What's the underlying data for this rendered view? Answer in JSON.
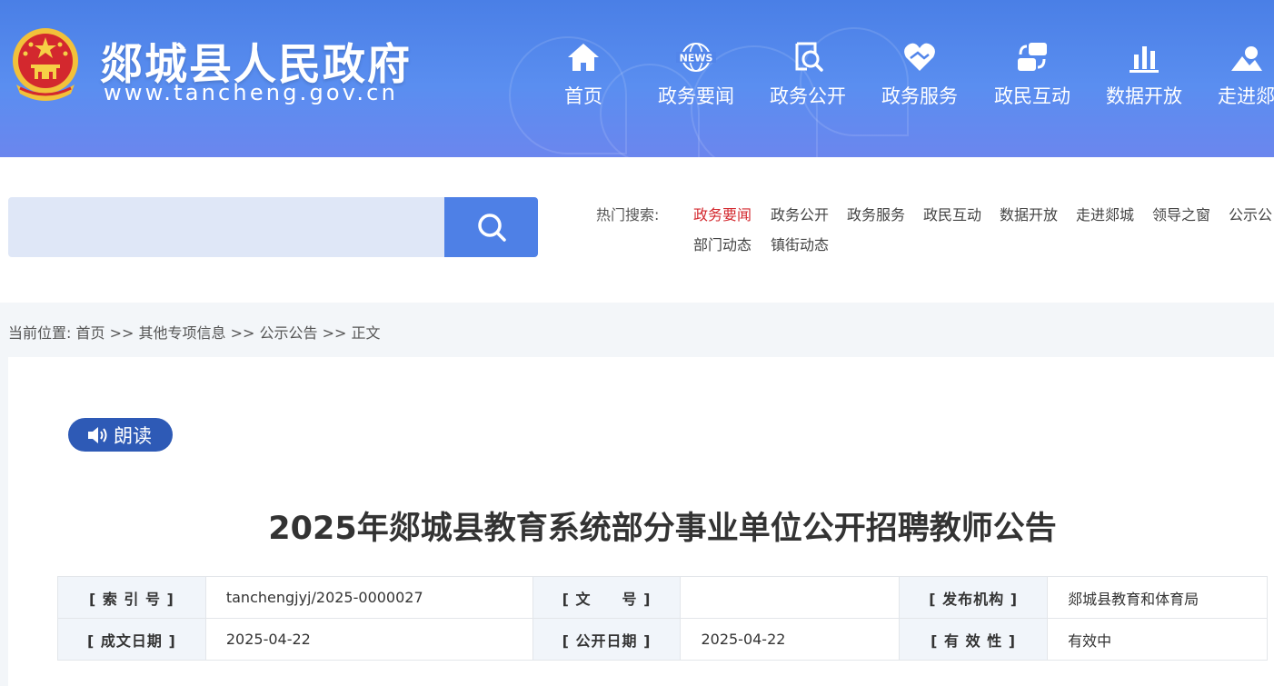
{
  "header": {
    "site_title": "郯城县人民政府",
    "site_url": "www.tancheng.gov.cn",
    "brand_color": "#4a7fe6",
    "nav": [
      {
        "label": "首页",
        "icon": "home-icon"
      },
      {
        "label": "政务要闻",
        "icon": "news-globe-icon",
        "icon_text": "NEWS"
      },
      {
        "label": "政务公开",
        "icon": "document-search-icon"
      },
      {
        "label": "政务服务",
        "icon": "heart-hands-icon"
      },
      {
        "label": "政民互动",
        "icon": "chat-exchange-icon"
      },
      {
        "label": "数据开放",
        "icon": "bar-chart-icon"
      },
      {
        "label": "走进郯"
      }
    ]
  },
  "search": {
    "placeholder": "",
    "button_icon": "search-icon",
    "hot_label": "热门搜索:",
    "hot_links": [
      "政务要闻",
      "政务公开",
      "政务服务",
      "政民互动",
      "数据开放",
      "走进郯城",
      "领导之窗",
      "公示公",
      "部门动态",
      "镇街动态"
    ],
    "active_color": "#d3282e"
  },
  "breadcrumb": {
    "prefix": "当前位置:",
    "items": [
      "首页",
      "其他专项信息",
      "公示公告",
      "正文"
    ],
    "separator": ">>"
  },
  "article": {
    "read_label": "朗读",
    "title": "2025年郯城县教育系统部分事业单位公开招聘教师公告"
  },
  "meta_table": {
    "rows": [
      [
        {
          "key": "[ 索 引 号 ]",
          "value": "tanchengjyj/2025-0000027"
        },
        {
          "key": "[ 文　　号 ]",
          "value": ""
        },
        {
          "key": "[ 发布机构 ]",
          "value": "郯城县教育和体育局"
        }
      ],
      [
        {
          "key": "[ 成文日期 ]",
          "value": "2025-04-22"
        },
        {
          "key": "[ 公开日期 ]",
          "value": "2025-04-22"
        },
        {
          "key": "[ 有 效 性 ]",
          "value": "有效中"
        }
      ]
    ]
  }
}
